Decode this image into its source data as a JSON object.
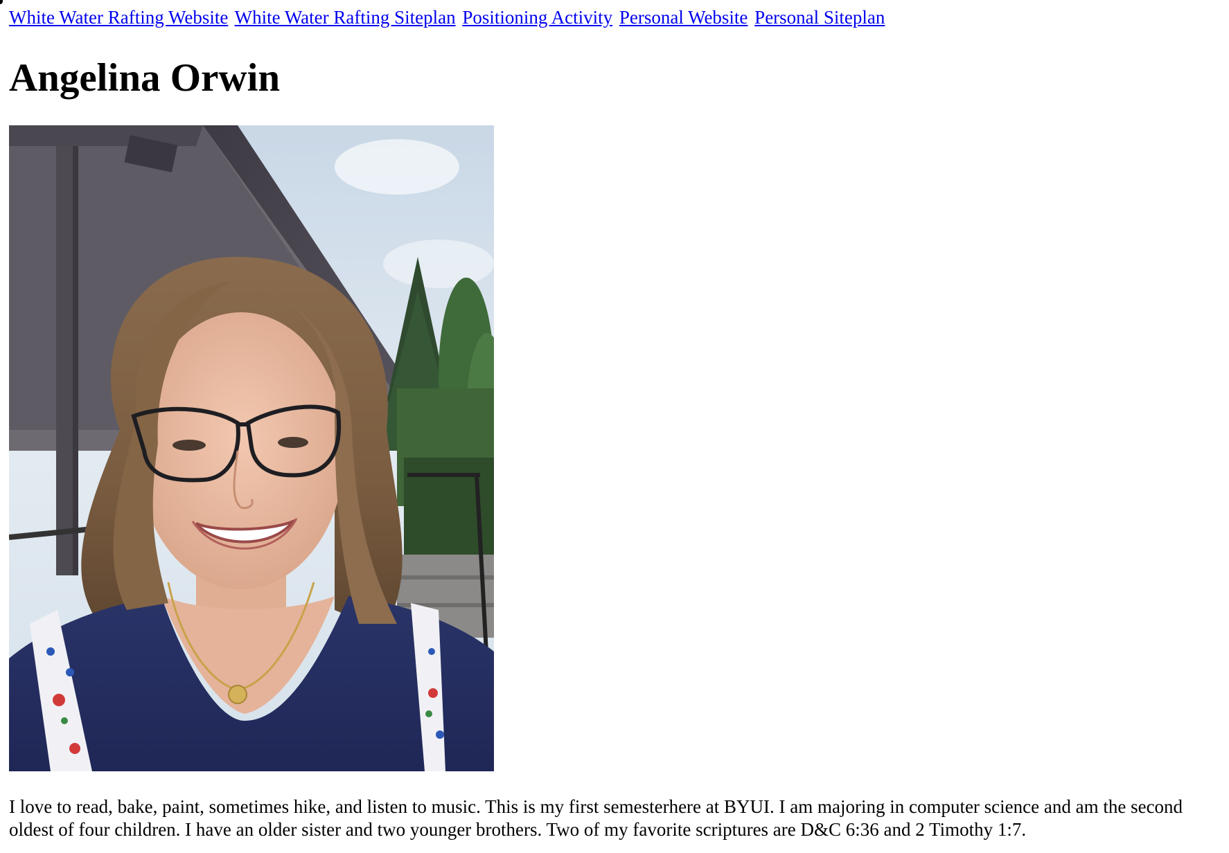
{
  "nav": {
    "links": [
      "White Water Rafting Website",
      "White Water Rafting Siteplan",
      "Positioning Activity",
      "Personal Website",
      "Personal Siteplan"
    ]
  },
  "page": {
    "title": "Angelina Orwin",
    "bio": "I love to read, bake, paint, sometimes hike, and listen to music. This is my first semesterhere at BYUI. I am majoring in computer science and am the second oldest of four children. I have an older sister and two younger brothers. Two of my favorite scriptures are D&C 6:36 and 2 Timothy 1:7."
  },
  "colors": {
    "link": "#0000ee",
    "text": "#000000",
    "background": "#ffffff"
  }
}
